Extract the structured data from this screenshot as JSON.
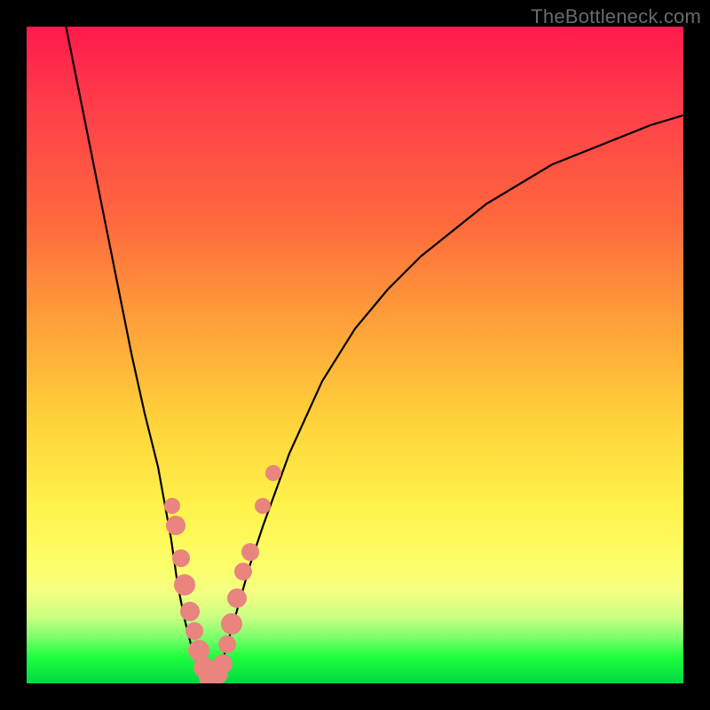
{
  "watermark": "TheBottleneck.com",
  "chart_data": {
    "type": "line",
    "title": "",
    "xlabel": "",
    "ylabel": "",
    "xlim": [
      0,
      100
    ],
    "ylim": [
      0,
      100
    ],
    "grid": false,
    "legend": false,
    "annotations": [],
    "background_gradient": {
      "direction": "vertical",
      "stops": [
        {
          "pos": 0,
          "color": "#ff1a4d"
        },
        {
          "pos": 30,
          "color": "#ff6a3d"
        },
        {
          "pos": 60,
          "color": "#ffd23a"
        },
        {
          "pos": 86,
          "color": "#f5ff80"
        },
        {
          "pos": 96,
          "color": "#1eff3e"
        },
        {
          "pos": 100,
          "color": "#00d943"
        }
      ]
    },
    "series": [
      {
        "name": "left-branch",
        "stroke": "#000000",
        "stroke_width": 2.2,
        "x": [
          6,
          8,
          10,
          12,
          14,
          16,
          18,
          20,
          22,
          23,
          24,
          25,
          26,
          27,
          28
        ],
        "y": [
          100,
          90,
          80,
          70,
          60,
          50,
          41,
          33,
          22,
          15,
          10,
          6,
          3,
          1,
          0
        ]
      },
      {
        "name": "right-branch",
        "stroke": "#000000",
        "stroke_width": 2.2,
        "x": [
          28,
          29,
          30,
          32,
          34,
          36,
          40,
          45,
          50,
          55,
          60,
          65,
          70,
          75,
          80,
          85,
          90,
          95,
          100
        ],
        "y": [
          0,
          1,
          4,
          11,
          18,
          24,
          35,
          46,
          54,
          60,
          65,
          69,
          73,
          76,
          79,
          81,
          83,
          85,
          86.5
        ]
      }
    ],
    "markers": {
      "color": "#e9847f",
      "shape": "circle",
      "points": [
        {
          "x": 22.2,
          "y": 27,
          "r": 9
        },
        {
          "x": 22.7,
          "y": 24,
          "r": 11
        },
        {
          "x": 23.5,
          "y": 19,
          "r": 10
        },
        {
          "x": 24.0,
          "y": 15,
          "r": 12
        },
        {
          "x": 24.8,
          "y": 11,
          "r": 11
        },
        {
          "x": 25.5,
          "y": 8,
          "r": 10
        },
        {
          "x": 26.2,
          "y": 5,
          "r": 12
        },
        {
          "x": 27.0,
          "y": 2.5,
          "r": 12
        },
        {
          "x": 28.0,
          "y": 1,
          "r": 13
        },
        {
          "x": 29.0,
          "y": 1.5,
          "r": 12
        },
        {
          "x": 29.8,
          "y": 3,
          "r": 11
        },
        {
          "x": 30.5,
          "y": 6,
          "r": 10
        },
        {
          "x": 31.2,
          "y": 9,
          "r": 12
        },
        {
          "x": 32.0,
          "y": 13,
          "r": 11
        },
        {
          "x": 33.0,
          "y": 17,
          "r": 10
        },
        {
          "x": 34.0,
          "y": 20,
          "r": 10
        },
        {
          "x": 36.0,
          "y": 27,
          "r": 9
        },
        {
          "x": 37.5,
          "y": 32,
          "r": 9
        }
      ]
    }
  }
}
